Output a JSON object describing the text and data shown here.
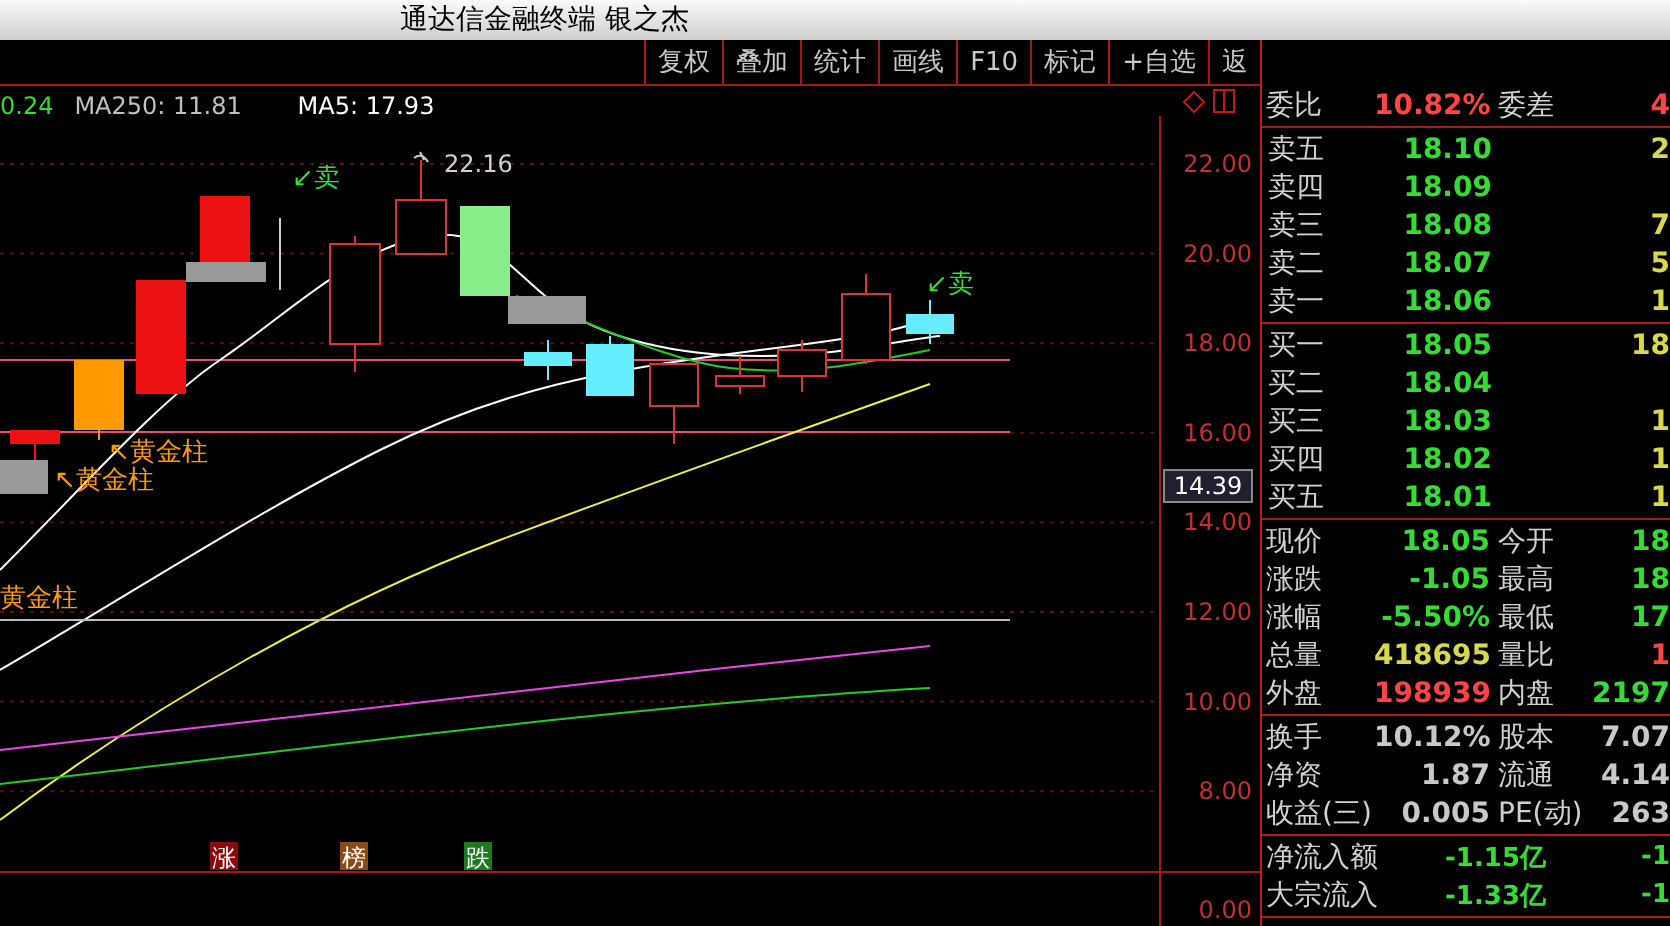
{
  "window": {
    "title": "通达信金融终端 银之杰"
  },
  "toolbar": {
    "buttons": [
      {
        "label": "复权"
      },
      {
        "label": "叠加"
      },
      {
        "label": "统计"
      },
      {
        "label": "画线"
      },
      {
        "label": "F10"
      },
      {
        "label": "标记"
      },
      {
        "label": "+自选"
      },
      {
        "label": "返"
      }
    ]
  },
  "chart": {
    "indicators": [
      {
        "text": "0.24",
        "color": "#33dd33"
      },
      {
        "text": "MA250: 11.81",
        "color": "#c0c0c0"
      },
      {
        "text": "MA5: 17.93",
        "color": "#ffffff"
      }
    ],
    "price_ticks": [
      "22.00",
      "20.00",
      "18.00",
      "16.00",
      "14.00",
      "12.00",
      "10.00",
      "8.00"
    ],
    "current_price_tag": "14.39",
    "high_label": "22.16",
    "signals": [
      {
        "kind": "sell",
        "text": "↙卖"
      },
      {
        "kind": "sell",
        "text": "↙卖"
      },
      {
        "kind": "gold",
        "text": "↖黄金柱"
      },
      {
        "kind": "gold",
        "text": "↖黄金柱"
      },
      {
        "kind": "gold",
        "text": "黄金柱"
      }
    ]
  },
  "indicator_pane": {
    "tags": [
      {
        "text": "涨",
        "color": "#8b0a0a"
      },
      {
        "text": "榜",
        "color": "#8b4a13"
      },
      {
        "text": "跌",
        "color": "#1e7a1e"
      }
    ],
    "axis_label": "0.00"
  },
  "quote_panel": {
    "order_ratio": {
      "cells": [
        {
          "label": "委比",
          "value": "10.82%",
          "kind": "up"
        },
        {
          "label": "委差",
          "value": "4",
          "kind": "up"
        }
      ]
    },
    "asks": [
      {
        "label": "卖五",
        "price": "18.10",
        "volume": "2"
      },
      {
        "label": "卖四",
        "price": "18.09"
      },
      {
        "label": "卖三",
        "price": "18.08",
        "volume": "7"
      },
      {
        "label": "卖二",
        "price": "18.07",
        "volume": "5"
      },
      {
        "label": "卖一",
        "price": "18.06",
        "volume": "1"
      }
    ],
    "bids": [
      {
        "label": "买一",
        "price": "18.05",
        "volume": "18"
      },
      {
        "label": "买二",
        "price": "18.04"
      },
      {
        "label": "买三",
        "price": "18.03",
        "volume": "1"
      },
      {
        "label": "买四",
        "price": "18.02",
        "volume": "1"
      },
      {
        "label": "买五",
        "price": "18.01",
        "volume": "1"
      }
    ],
    "quotes": [
      {
        "cells": [
          {
            "label": "现价",
            "value": "18.05",
            "kind": "down"
          },
          {
            "label": "今开",
            "value": "18",
            "kind": "down"
          }
        ]
      },
      {
        "cells": [
          {
            "label": "涨跌",
            "value": "-1.05",
            "kind": "down"
          },
          {
            "label": "最高",
            "value": "18",
            "kind": "down"
          }
        ]
      },
      {
        "cells": [
          {
            "label": "涨幅",
            "value": "-5.50%",
            "kind": "down"
          },
          {
            "label": "最低",
            "value": "17",
            "kind": "down"
          }
        ]
      },
      {
        "cells": [
          {
            "label": "总量",
            "value": "418695",
            "kind": "volume"
          },
          {
            "label": "量比",
            "value": "1",
            "kind": "up"
          }
        ]
      },
      {
        "cells": [
          {
            "label": "外盘",
            "value": "198939",
            "kind": "up"
          },
          {
            "label": "内盘",
            "value": "2197",
            "kind": "down"
          }
        ]
      }
    ],
    "fundamentals": [
      {
        "cells": [
          {
            "label": "换手",
            "value": "10.12%"
          },
          {
            "label": "股本",
            "value": "7.07"
          }
        ]
      },
      {
        "cells": [
          {
            "label": "净资",
            "value": "1.87"
          },
          {
            "label": "流通",
            "value": "4.14"
          }
        ]
      },
      {
        "cells": [
          {
            "label": "收益(三)",
            "value": "0.005"
          },
          {
            "label": "PE(动)",
            "value": "263"
          }
        ]
      }
    ],
    "flows": [
      {
        "cells": [
          {
            "label": "净流入额",
            "value": "-1.15亿",
            "kind": "down"
          },
          {
            "value": "-1",
            "kind": "down"
          }
        ]
      },
      {
        "cells": [
          {
            "label": "大宗流入",
            "value": "-1.33亿",
            "kind": "down"
          },
          {
            "value": "-1",
            "kind": "down"
          }
        ]
      }
    ]
  }
}
